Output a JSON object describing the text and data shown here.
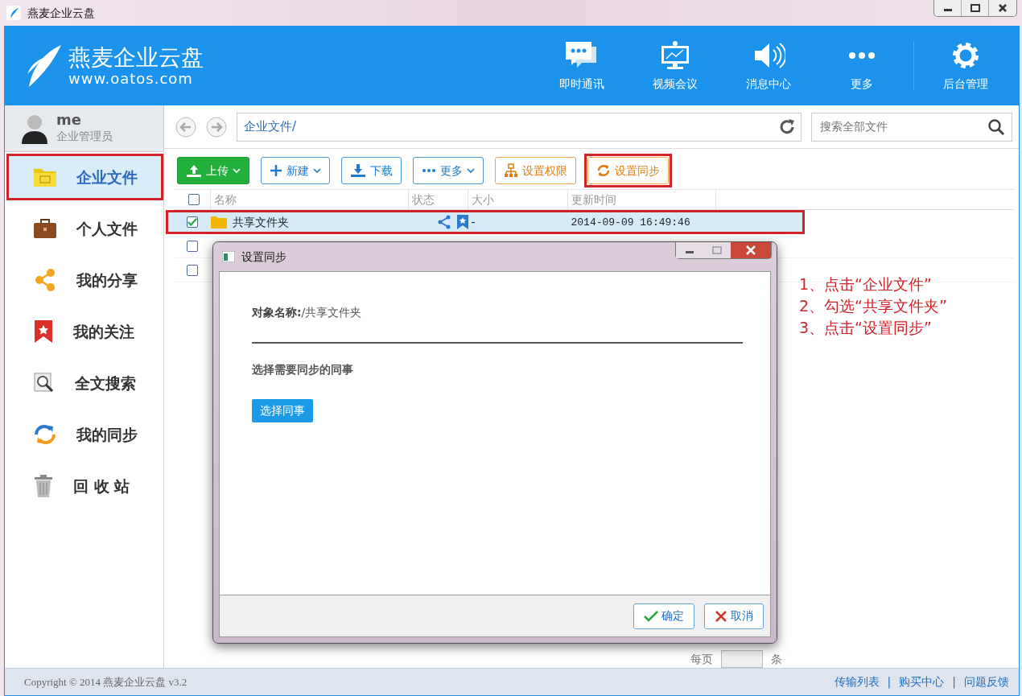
{
  "window": {
    "title": "燕麦企业云盘"
  },
  "header": {
    "logo_name": "燕麦企业云盘",
    "logo_url": "www.oatos.com",
    "items": [
      {
        "kind": "chat",
        "label": "即时通讯"
      },
      {
        "kind": "video",
        "label": "视频会议"
      },
      {
        "kind": "speaker",
        "label": "消息中心"
      },
      {
        "kind": "dots",
        "label": "更多"
      },
      {
        "kind": "gear",
        "label": "后台管理"
      }
    ]
  },
  "user": {
    "name": "me",
    "role": "企业管理员"
  },
  "sidebar": {
    "items": [
      {
        "kind": "folder",
        "label": "企业文件",
        "selected": true,
        "highlighted": true
      },
      {
        "kind": "briefcase",
        "label": "个人文件",
        "selected": false,
        "highlighted": false
      },
      {
        "kind": "share",
        "label": "我的分享",
        "selected": false,
        "highlighted": false
      },
      {
        "kind": "bookmark",
        "label": "我的关注",
        "selected": false,
        "highlighted": false
      },
      {
        "kind": "search",
        "label": "全文搜索",
        "selected": false,
        "highlighted": false
      },
      {
        "kind": "sync",
        "label": "我的同步",
        "selected": false,
        "highlighted": false
      },
      {
        "kind": "trash",
        "label": "回 收 站",
        "selected": false,
        "highlighted": false
      }
    ]
  },
  "path": {
    "value": "企业文件/"
  },
  "search": {
    "placeholder": "搜索全部文件"
  },
  "toolbar": [
    {
      "kind": "upload",
      "label": "上传",
      "dropdown": true,
      "highlighted": false
    },
    {
      "kind": "plus",
      "label": "新建",
      "dropdown": true,
      "highlighted": false
    },
    {
      "kind": "download",
      "label": "下载",
      "dropdown": false,
      "highlighted": false
    },
    {
      "kind": "dots",
      "label": "更多",
      "dropdown": true,
      "highlighted": false
    },
    {
      "kind": "tree",
      "label": "设置权限",
      "dropdown": false,
      "highlighted": false
    },
    {
      "kind": "sync",
      "label": "设置同步",
      "dropdown": false,
      "highlighted": true
    }
  ],
  "table": {
    "columns": [
      "名称",
      "状态",
      "大小",
      "更新时间"
    ],
    "header_checked": false,
    "rows": [
      {
        "checked": true,
        "selected": true,
        "highlighted": true,
        "name": "共享文件夹",
        "shared": true,
        "bookmarked": true,
        "size": "-",
        "updated": "2014-09-09 16:49:46"
      },
      {
        "checked": false,
        "selected": false,
        "highlighted": false
      },
      {
        "checked": false,
        "selected": false,
        "highlighted": false
      }
    ]
  },
  "pager": {
    "per_page_label": "每页",
    "unit": "条"
  },
  "dialog": {
    "title": "设置同步",
    "object_label": "对象名称:",
    "object_value": "/共享文件夹",
    "section": "选择需要同步的同事",
    "select_button": "选择同事",
    "ok": "确定",
    "cancel": "取消"
  },
  "annotations": [
    "1、点击“企业文件”",
    "2、勾选“共享文件夹”",
    "3、点击“设置同步”"
  ],
  "footer": {
    "copyright": "Copyright © 2014 燕麦企业云盘 v3.2",
    "links": [
      "传输列表",
      "购买中心",
      "问题反馈"
    ],
    "separators": [
      "|",
      "|"
    ]
  }
}
